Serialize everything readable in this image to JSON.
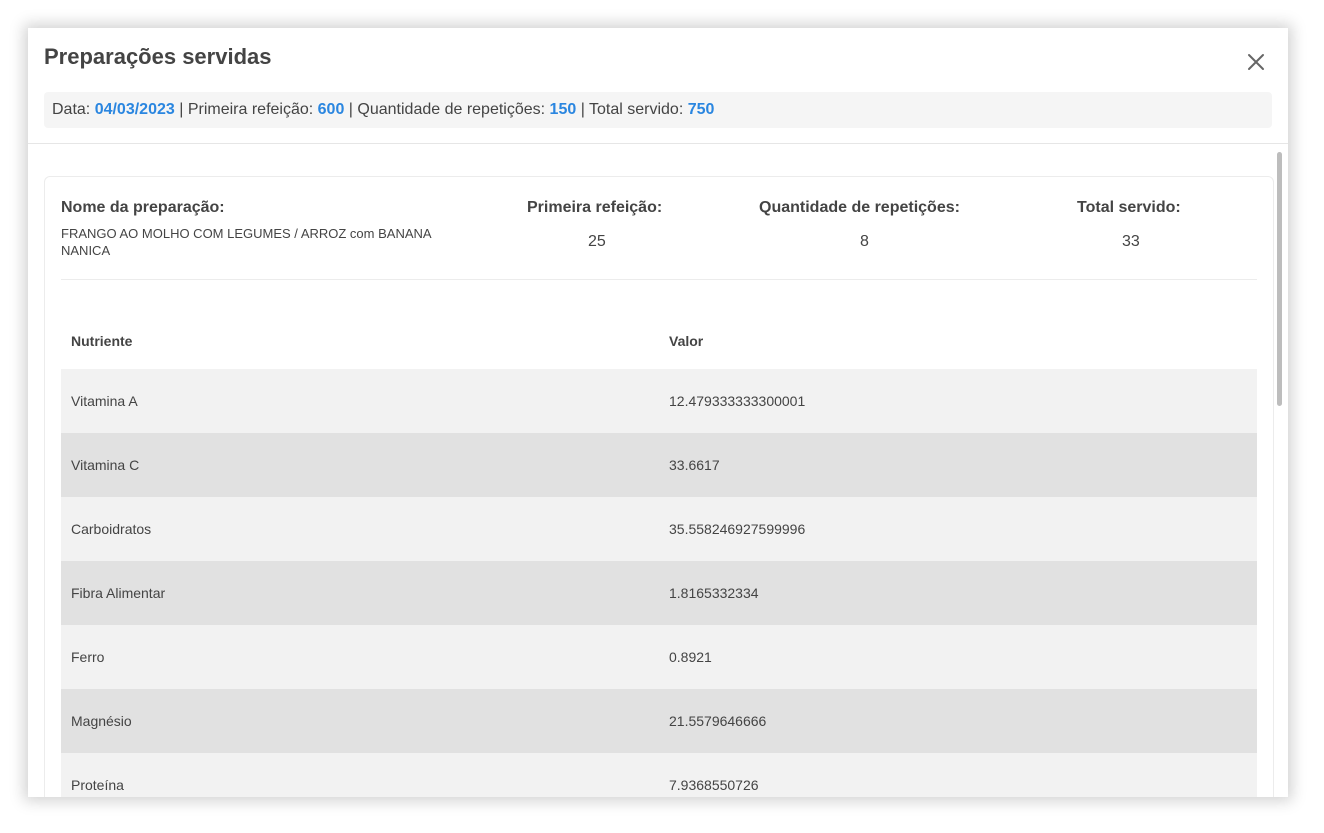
{
  "modal": {
    "title": "Preparações servidas",
    "close_icon": "close-icon"
  },
  "summary": {
    "date_label": "Data:",
    "date_value": "04/03/2023",
    "first_meal_label": "Primeira refeição:",
    "first_meal_value": "600",
    "repetitions_label": "Quantidade de repetições:",
    "repetitions_value": "150",
    "total_label": "Total servido:",
    "total_value": "750",
    "separator": "|"
  },
  "preparation": {
    "name_label": "Nome da preparação:",
    "name_value": "FRANGO AO MOLHO COM LEGUMES / ARROZ com BANANA NANICA",
    "first_meal_label": "Primeira refeição:",
    "first_meal_value": "25",
    "repetitions_label": "Quantidade de repetições:",
    "repetitions_value": "8",
    "total_label": "Total servido:",
    "total_value": "33"
  },
  "table": {
    "headers": [
      "Nutriente",
      "Valor"
    ],
    "rows": [
      {
        "nutrient": "Vitamina A",
        "value": "12.479333333300001"
      },
      {
        "nutrient": "Vitamina C",
        "value": "33.6617"
      },
      {
        "nutrient": "Carboidratos",
        "value": "35.558246927599996"
      },
      {
        "nutrient": "Fibra Alimentar",
        "value": "1.8165332334"
      },
      {
        "nutrient": "Ferro",
        "value": "0.8921"
      },
      {
        "nutrient": "Magnésio",
        "value": "21.5579646666"
      },
      {
        "nutrient": "Proteína",
        "value": "7.9368550726"
      }
    ]
  },
  "colors": {
    "accent": "#2a86e0",
    "text": "#444444",
    "row_light": "#f2f2f2",
    "row_dark": "#e1e1e1"
  }
}
